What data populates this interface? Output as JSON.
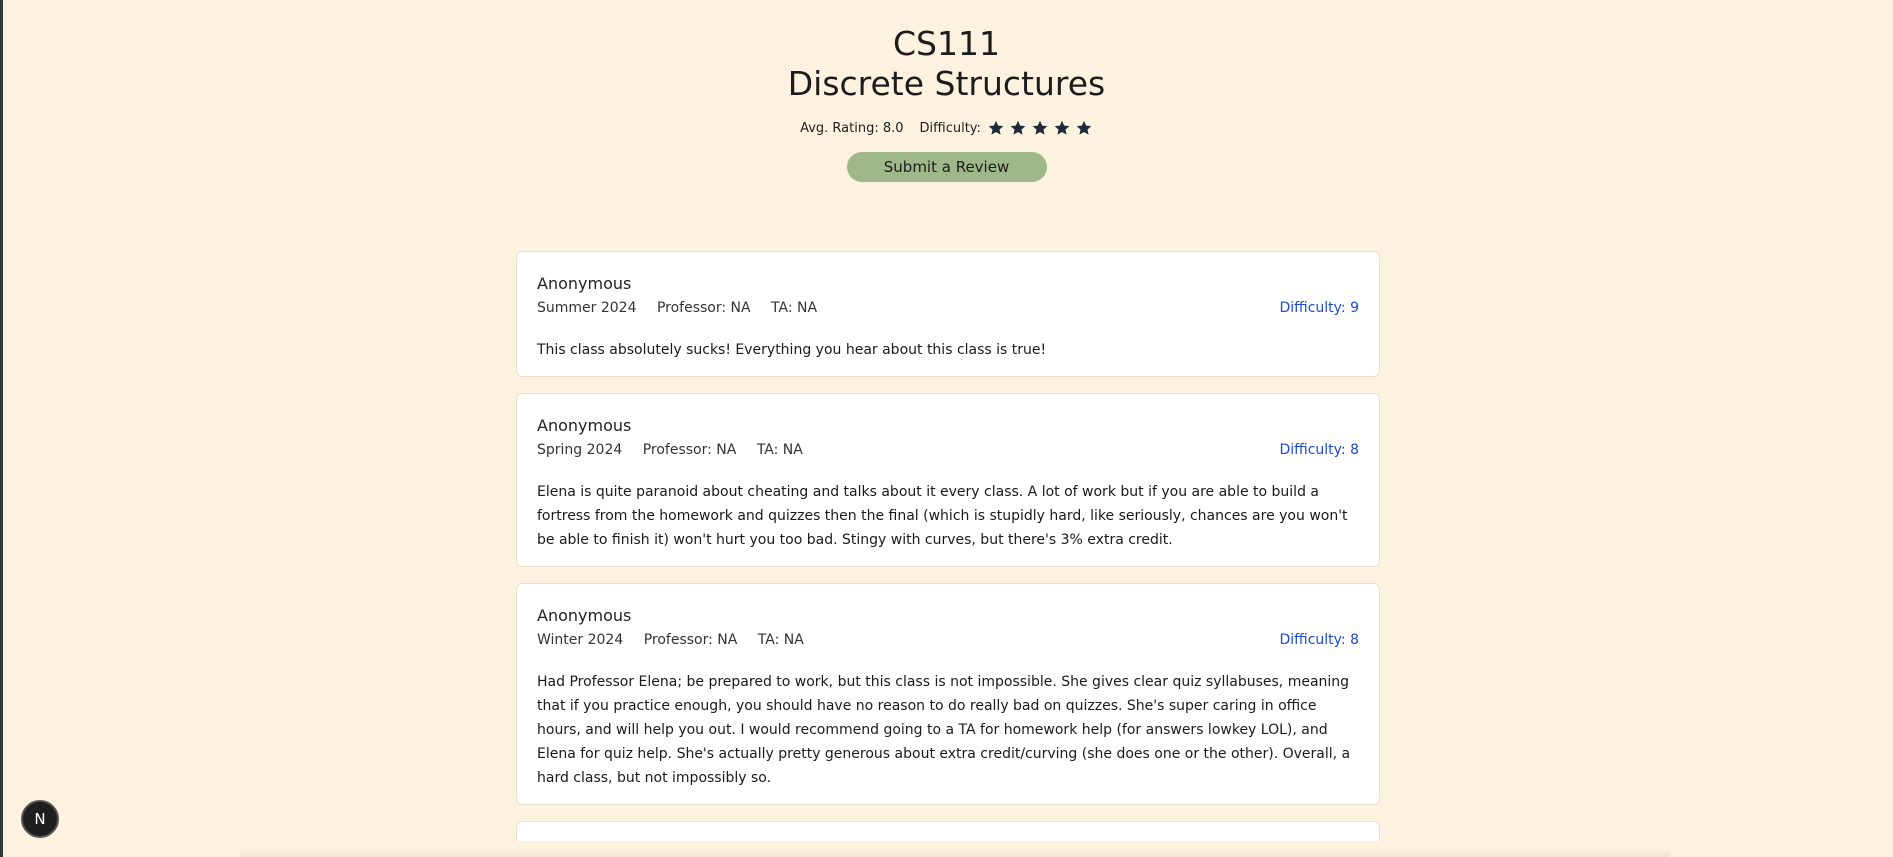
{
  "course": {
    "code": "CS111",
    "name": "Discrete Structures"
  },
  "stats": {
    "avg_rating": "Avg. Rating: 8.0",
    "difficulty_label": "Difficulty:",
    "difficulty_stars": 5,
    "star_color": "#1e2a3a"
  },
  "submit_button": {
    "label": "Submit a Review",
    "color": "#9eb889"
  },
  "reviews": [
    {
      "author": "Anonymous",
      "term": "Summer 2024",
      "professor": "Professor: NA",
      "ta": "TA: NA",
      "difficulty": "Difficulty: 9",
      "text": "This class absolutely sucks! Everything you hear about this class is true!"
    },
    {
      "author": "Anonymous",
      "term": "Spring 2024",
      "professor": "Professor: NA",
      "ta": "TA: NA",
      "difficulty": "Difficulty: 8",
      "text": "Elena is quite paranoid about cheating and talks about it every class. A lot of work but if you are able to build a fortress from the homework and quizzes then the final (which is stupidly hard, like seriously, chances are you won't be able to finish it) won't hurt you too bad. Stingy with curves, but there's 3% extra credit."
    },
    {
      "author": "Anonymous",
      "term": "Winter 2024",
      "professor": "Professor: NA",
      "ta": "TA: NA",
      "difficulty": "Difficulty: 8",
      "text": "Had Professor Elena; be prepared to work, but this class is not impossible. She gives clear quiz syllabuses, meaning that if you practice enough, you should have no reason to do really bad on quizzes. She's super caring in office hours, and will help you out. I would recommend going to a TA for homework help (for answers lowkey LOL), and Elena for quiz help. She's actually pretty generous about extra credit/curving (she does one or the other). Overall, a hard class, but not impossibly so."
    }
  ],
  "dev_badge": {
    "letter": "N"
  },
  "colors": {
    "background": "#fdf1df",
    "difficulty_text": "#1d4bd1"
  }
}
